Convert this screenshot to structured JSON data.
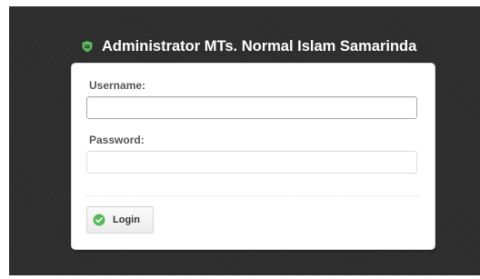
{
  "header": {
    "title": "Administrator MTs. Normal Islam Samarinda",
    "icon": "shield-icon",
    "icon_color": "#5cb85c"
  },
  "form": {
    "username_label": "Username:",
    "username_value": "",
    "password_label": "Password:",
    "password_value": "",
    "login_label": "Login",
    "login_icon": "check-circle-icon",
    "login_icon_color": "#5cb85c"
  }
}
